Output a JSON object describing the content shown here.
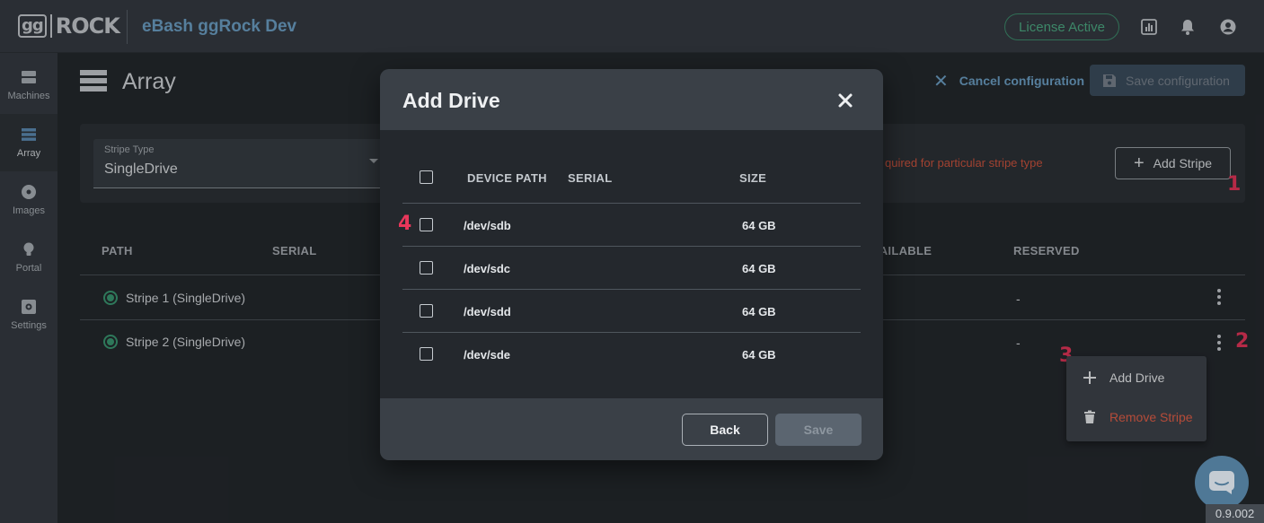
{
  "header": {
    "logo_gg": "gg",
    "logo_rock": "ROCK",
    "app_title": "eBash ggRock Dev",
    "license_badge": "License Active",
    "icons": [
      "chart-icon",
      "bell-icon",
      "account-icon"
    ]
  },
  "sidebar": {
    "items": [
      {
        "label": "Machines",
        "icon": "machines-icon",
        "active": false
      },
      {
        "label": "Array",
        "icon": "array-icon",
        "active": true
      },
      {
        "label": "Images",
        "icon": "disc-icon",
        "active": false
      },
      {
        "label": "Portal",
        "icon": "bulb-icon",
        "active": false
      },
      {
        "label": "Settings",
        "icon": "settings-icon",
        "active": false
      }
    ]
  },
  "page": {
    "title": "Array",
    "cancel_label": "Cancel configuration",
    "save_label": "Save configuration"
  },
  "config": {
    "stripe_type_label": "Stripe Type",
    "stripe_type_value": "SingleDrive",
    "warning": "quired for particular stripe type",
    "add_stripe_label": "Add Stripe"
  },
  "table": {
    "headers": {
      "path": "PATH",
      "serial": "SERIAL",
      "available": "AVAILABLE",
      "reserved": "RESERVED"
    },
    "rows": [
      {
        "name": "Stripe 1 (SingleDrive)",
        "reserved": "-"
      },
      {
        "name": "Stripe 2 (SingleDrive)",
        "reserved": "-"
      }
    ]
  },
  "context_menu": {
    "add_drive": "Add Drive",
    "remove_stripe": "Remove Stripe"
  },
  "markers": [
    "1",
    "2",
    "3",
    "4"
  ],
  "modal": {
    "title": "Add Drive",
    "headers": {
      "device_path": "DEVICE PATH",
      "serial": "SERIAL",
      "size": "SIZE"
    },
    "drives": [
      {
        "path": "/dev/sdb",
        "serial": "",
        "size": "64 GB"
      },
      {
        "path": "/dev/sdc",
        "serial": "",
        "size": "64 GB"
      },
      {
        "path": "/dev/sdd",
        "serial": "",
        "size": "64 GB"
      },
      {
        "path": "/dev/sde",
        "serial": "",
        "size": "64 GB"
      }
    ],
    "back_label": "Back",
    "save_label": "Save"
  },
  "version": "0.9.002",
  "colors": {
    "accent": "#6fa3c9",
    "success": "#4fae86",
    "danger": "#e8375b",
    "warning_text": "#d0553f"
  }
}
